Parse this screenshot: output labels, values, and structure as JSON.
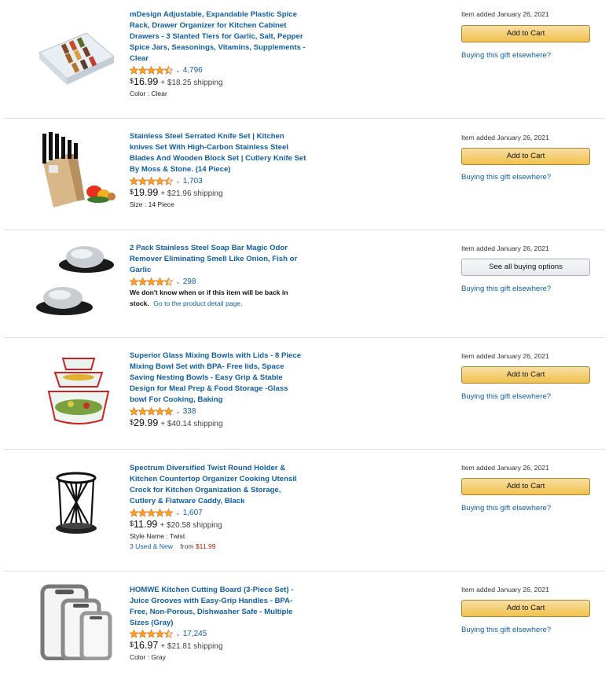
{
  "colors": {
    "link": "#0f5ea8",
    "cart_button": "#f0c14b",
    "star": "#ffa41c",
    "used_price": "#b12704"
  },
  "items": [
    {
      "title": "mDesign Adjustable, Expandable Plastic Spice Rack, Drawer Organizer for Kitchen Cabinet Drawers - 3 Slanted Tiers for Garlic, Salt, Pepper Spice Jars, Seasonings, Vitamins, Supplements - Clear",
      "rating": 4.5,
      "rating_count": "4,796",
      "price_symbol": "$",
      "price": "16.99",
      "shipping": "+ $18.25 shipping",
      "attribute": "Color : Clear",
      "added": "Item added January 26, 2021",
      "button": "Add to Cart",
      "elsewhere": "Buying this gift elsewhere?",
      "image": "spice-rack-image"
    },
    {
      "title": "Stainless Steel Serrated Knife Set | Kitchen knives Set With High-Carbon Stainless Steel Blades And Wooden Block Set | Cutlery Knife Set By Moss & Stone. (14 Piece)",
      "rating": 4.5,
      "rating_count": "1,703",
      "price_symbol": "$",
      "price": "19.99",
      "shipping": "+ $21.96 shipping",
      "attribute": "Size : 14 Piece",
      "added": "Item added January 26, 2021",
      "button": "Add to Cart",
      "elsewhere": "Buying this gift elsewhere?",
      "image": "knife-set-image"
    },
    {
      "title": "2 Pack Stainless Steel Soap Bar Magic Odor Remover Eliminating Smell Like Onion, Fish or Garlic",
      "rating": 4.5,
      "rating_count": "298",
      "unavailable_text": "We don't know when or if this item will be back in stock.",
      "detail_link": "Go to the product detail page.",
      "added": "Item added January 26, 2021",
      "button": "See all buying options",
      "elsewhere": "Buying this gift elsewhere?",
      "image": "soap-bar-image"
    },
    {
      "title": "Superior Glass Mixing Bowls with Lids - 8 Piece Mixing Bowl Set with BPA- Free lids, Space Saving Nesting Bowls - Easy Grip & Stable Design for Meal Prep & Food Storage -Glass bowl For Cooking, Baking",
      "rating": 5,
      "rating_count": "338",
      "price_symbol": "$",
      "price": "29.99",
      "shipping": "+ $40.14 shipping",
      "added": "Item added January 26, 2021",
      "button": "Add to Cart",
      "elsewhere": "Buying this gift elsewhere?",
      "image": "mixing-bowls-image"
    },
    {
      "title": "Spectrum Diversified Twist Round Holder & Kitchen Countertop Organizer Cooking Utensil Crock for Kitchen Organization & Storage, Cutlery & Flatware Caddy, Black",
      "rating": 5,
      "rating_count": "1,607",
      "price_symbol": "$",
      "price": "11.99",
      "shipping": "+ $20.58 shipping",
      "attribute": "Style Name : Twist",
      "used_link": "3 Used & New",
      "used_from": "from",
      "used_price": "$11.99",
      "added": "Item added January 26, 2021",
      "button": "Add to Cart",
      "elsewhere": "Buying this gift elsewhere?",
      "image": "utensil-holder-image"
    },
    {
      "title": "HOMWE Kitchen Cutting Board (3-Piece Set) - Juice Grooves with Easy-Grip Handles - BPA-Free, Non-Porous, Dishwasher Safe - Multiple Sizes (Gray)",
      "rating": 4.5,
      "rating_count": "17,245",
      "price_symbol": "$",
      "price": "16.97",
      "shipping": "+ $21.81 shipping",
      "attribute": "Color : Gray",
      "added": "Item added January 26, 2021",
      "button": "Add to Cart",
      "elsewhere": "Buying this gift elsewhere?",
      "image": "cutting-board-image"
    }
  ]
}
